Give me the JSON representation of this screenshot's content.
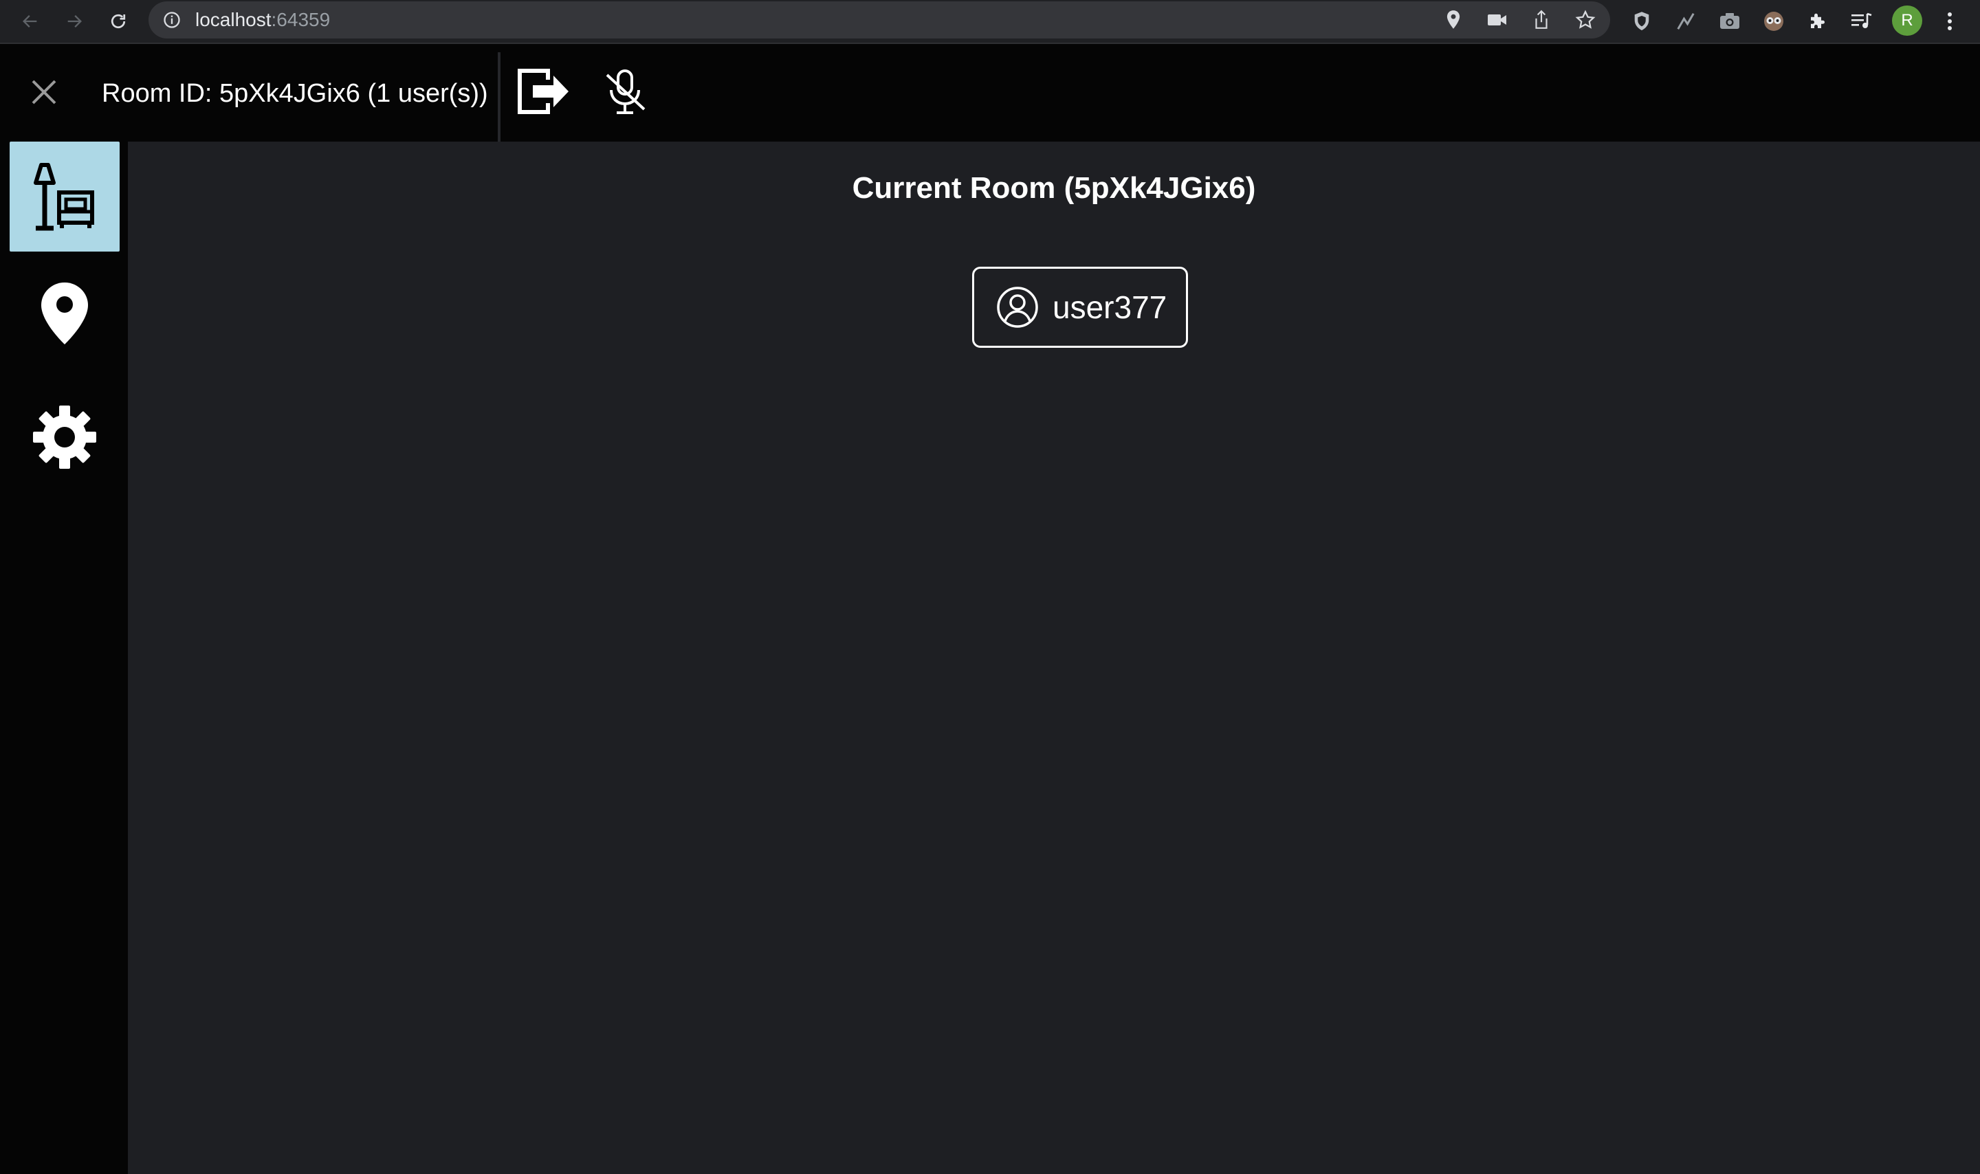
{
  "browser": {
    "url_host": "localhost",
    "url_port": ":64359",
    "profile_initial": "R"
  },
  "header": {
    "room_label": "Room ID: 5pXk4JGix6 (1 user(s))"
  },
  "sidebar": {
    "items": [
      {
        "name": "room",
        "icon": "lamp-sofa-icon",
        "active": true
      },
      {
        "name": "location",
        "icon": "map-pin-icon",
        "active": false
      },
      {
        "name": "settings",
        "icon": "gear-icon",
        "active": false
      }
    ]
  },
  "main": {
    "title": "Current Room (5pXk4JGix6)",
    "users": [
      {
        "username": "user377",
        "icon": "user-avatar-icon"
      }
    ]
  },
  "colors": {
    "active_tab": "#add8e6",
    "background": "#1e1f23",
    "header": "#050505",
    "profile": "#5d9e3c"
  }
}
